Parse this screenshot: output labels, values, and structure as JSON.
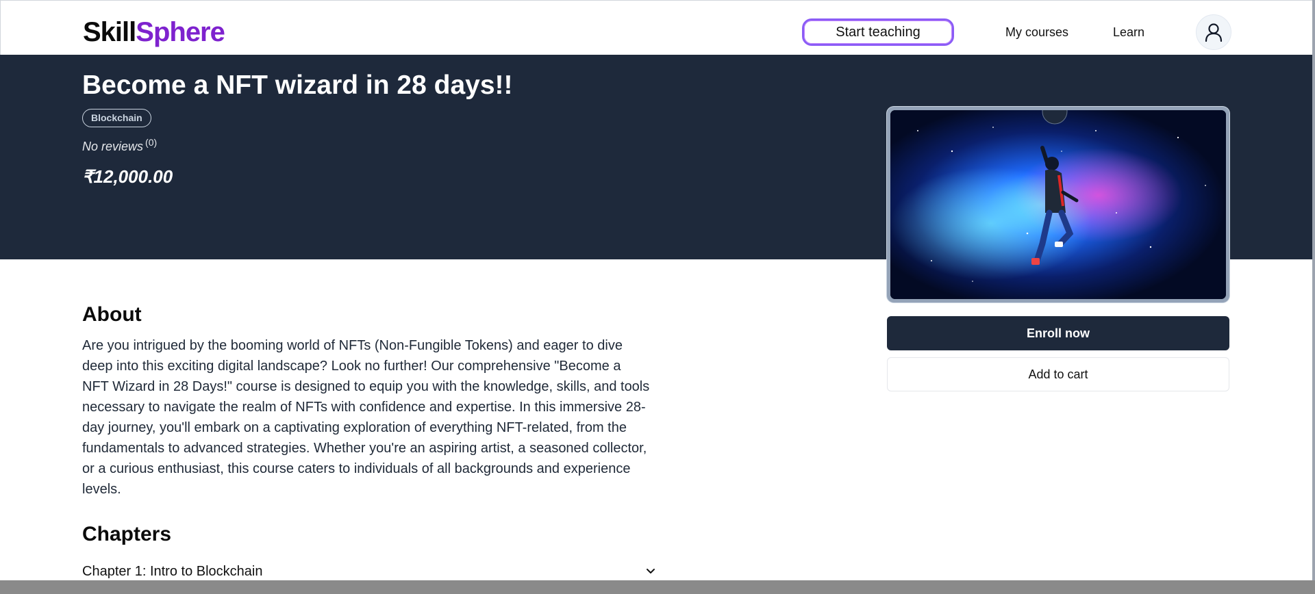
{
  "header": {
    "logo_part1": "Skill",
    "logo_part2": "Sphere",
    "start_teaching": "Start teaching",
    "my_courses": "My courses",
    "learn": "Learn",
    "profile_icon": "user-icon"
  },
  "course": {
    "title": "Become a NFT wizard in 28 days!!",
    "tag": "Blockchain",
    "reviews_label": "No reviews",
    "reviews_count": "(0)",
    "price": "₹12,000.00",
    "image_alt": "astronaut floating in galaxy"
  },
  "actions": {
    "enroll": "Enroll now",
    "add_to_cart": "Add to cart"
  },
  "about": {
    "heading": "About",
    "text": "Are you intrigued by the booming world of NFTs (Non-Fungible Tokens) and eager to dive deep into this exciting digital landscape? Look no further! Our comprehensive \"Become a NFT Wizard in 28 Days!\" course is designed to equip you with the knowledge, skills, and tools necessary to navigate the realm of NFTs with confidence and expertise. In this immersive 28-day journey, you'll embark on a captivating exploration of everything NFT-related, from the fundamentals to advanced strategies. Whether you're an aspiring artist, a seasoned collector, or a curious enthusiast, this course caters to individuals of all backgrounds and experience levels."
  },
  "chapters": {
    "heading": "Chapters",
    "items": [
      {
        "label": "Chapter 1: Intro to Blockchain",
        "icon": "chevron-down-icon"
      }
    ]
  },
  "colors": {
    "brand_purple": "#7e22ce",
    "hero_bg": "#1e293b",
    "enroll_bg": "#1e293b"
  }
}
